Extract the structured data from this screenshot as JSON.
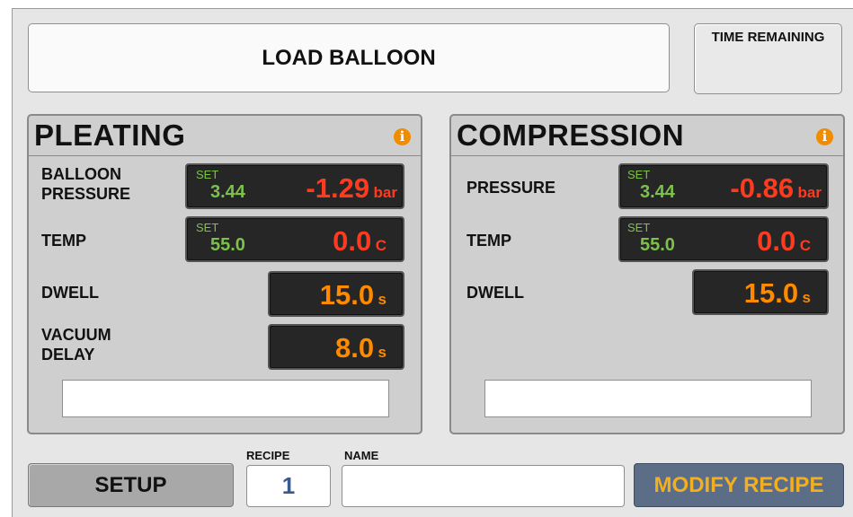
{
  "status": {
    "message": "LOAD BALLOON"
  },
  "time_remaining": {
    "label": "TIME REMAINING",
    "value": ""
  },
  "pleating": {
    "title": "PLEATING",
    "balloon_pressure": {
      "label_line1": "BALLOON",
      "label_line2": "PRESSURE",
      "set_label": "SET",
      "set_value": "3.44",
      "actual": "-1.29",
      "unit": "bar"
    },
    "temp": {
      "label": "TEMP",
      "set_label": "SET",
      "set_value": "55.0",
      "actual": "0.0",
      "unit": "C"
    },
    "dwell": {
      "label": "DWELL",
      "value": "15.0",
      "unit": "s"
    },
    "vacuum_delay": {
      "label_line1": "VACUUM",
      "label_line2": "DELAY",
      "value": "8.0",
      "unit": "s"
    },
    "message": ""
  },
  "compression": {
    "title": "COMPRESSION",
    "pressure": {
      "label": "PRESSURE",
      "set_label": "SET",
      "set_value": "3.44",
      "actual": "-0.86",
      "unit": "bar"
    },
    "temp": {
      "label": "TEMP",
      "set_label": "SET",
      "set_value": "55.0",
      "actual": "0.0",
      "unit": "C"
    },
    "dwell": {
      "label": "DWELL",
      "value": "15.0",
      "unit": "s"
    },
    "message": ""
  },
  "footer": {
    "setup_label": "SETUP",
    "recipe_label": "RECIPE",
    "recipe_number": "1",
    "name_label": "NAME",
    "name_value": "",
    "modify_label": "MODIFY RECIPE"
  },
  "colors": {
    "background": "#e6e6e6",
    "panel": "#cfcfcf",
    "readout_bg": "#262626",
    "set_green": "#7cc24a",
    "actual_red": "#ff3b1f",
    "dwell_orange": "#ff8a00",
    "info_orange": "#f08c00",
    "modify_bg": "#5c6d87",
    "modify_text": "#f2b01e",
    "recipe_text": "#3a5a8c"
  },
  "icons": {
    "info": "info-icon"
  }
}
